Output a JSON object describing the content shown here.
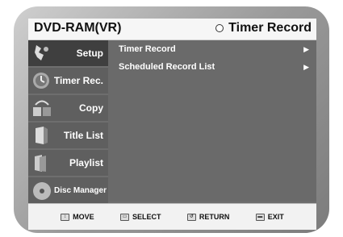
{
  "header": {
    "app_title": "DVD-RAM(VR)",
    "page_title": "Timer Record"
  },
  "sidebar": {
    "items": [
      {
        "label": "Setup",
        "icon": "setup-icon",
        "active": true
      },
      {
        "label": "Timer Rec.",
        "icon": "timer-icon",
        "active": false
      },
      {
        "label": "Copy",
        "icon": "copy-icon",
        "active": false
      },
      {
        "label": "Title List",
        "icon": "title-list-icon",
        "active": false
      },
      {
        "label": "Playlist",
        "icon": "playlist-icon",
        "active": false
      },
      {
        "label": "Disc Manager",
        "icon": "disc-icon",
        "active": false
      }
    ]
  },
  "menu": {
    "items": [
      {
        "label": "Timer Record",
        "arrow": "▶"
      },
      {
        "label": "Scheduled Record List",
        "arrow": "▶"
      }
    ]
  },
  "footer": {
    "move": "MOVE",
    "select": "SELECT",
    "return": "RETURN",
    "exit": "EXIT"
  },
  "colors": {
    "panel": "#6e6e6e",
    "sidebar_item": "#5f5f5f",
    "titlebar": "#f6f6f6"
  }
}
